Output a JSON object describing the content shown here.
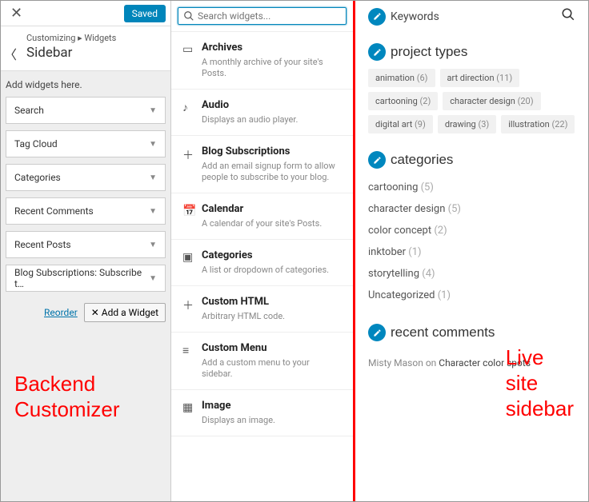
{
  "left": {
    "saved_label": "Saved",
    "breadcrumb_prefix": "Customizing",
    "breadcrumb_sep": "▸",
    "breadcrumb_current": "Widgets",
    "title": "Sidebar",
    "add_msg": "Add widgets here.",
    "widgets": [
      {
        "label": "Search"
      },
      {
        "label": "Tag Cloud"
      },
      {
        "label": "Categories"
      },
      {
        "label": "Recent Comments"
      },
      {
        "label": "Recent Posts"
      },
      {
        "label": "Blog Subscriptions: Subscribe t…"
      }
    ],
    "reorder": "Reorder",
    "add_widget": "Add a Widget",
    "annotation": "Backend\nCustomizer"
  },
  "mid": {
    "search_placeholder": "Search widgets...",
    "items": [
      {
        "icon": "archive",
        "title": "Archives",
        "desc": "A monthly archive of your site's Posts."
      },
      {
        "icon": "audio",
        "title": "Audio",
        "desc": "Displays an audio player."
      },
      {
        "icon": "plus",
        "title": "Blog Subscriptions",
        "desc": "Add an email signup form to allow people to subscribe to your blog."
      },
      {
        "icon": "calendar",
        "title": "Calendar",
        "desc": "A calendar of your site's Posts."
      },
      {
        "icon": "folder",
        "title": "Categories",
        "desc": "A list or dropdown of categories."
      },
      {
        "icon": "plus",
        "title": "Custom HTML",
        "desc": "Arbitrary HTML code."
      },
      {
        "icon": "menu",
        "title": "Custom Menu",
        "desc": "Add a custom menu to your sidebar."
      },
      {
        "icon": "image",
        "title": "Image",
        "desc": "Displays an image."
      }
    ]
  },
  "right": {
    "keywords_label": "Keywords",
    "sections": {
      "project_types": {
        "title": "project types",
        "tags": [
          {
            "name": "animation",
            "count": 6
          },
          {
            "name": "art direction",
            "count": 11
          },
          {
            "name": "cartooning",
            "count": 2
          },
          {
            "name": "character design",
            "count": 20
          },
          {
            "name": "digital art",
            "count": 9
          },
          {
            "name": "drawing",
            "count": 3
          },
          {
            "name": "illustration",
            "count": 22
          }
        ]
      },
      "categories": {
        "title": "categories",
        "items": [
          {
            "name": "cartooning",
            "count": 5
          },
          {
            "name": "character design",
            "count": 5
          },
          {
            "name": "color concept",
            "count": 2
          },
          {
            "name": "inktober",
            "count": 1
          },
          {
            "name": "storytelling",
            "count": 4
          },
          {
            "name": "Uncategorized",
            "count": 1
          }
        ]
      },
      "recent_comments": {
        "title": "recent comments",
        "items": [
          {
            "author": "Misty Mason",
            "on": "on",
            "post": "Character color spots"
          }
        ]
      }
    },
    "annotation": "Live\nsite\nsidebar"
  }
}
